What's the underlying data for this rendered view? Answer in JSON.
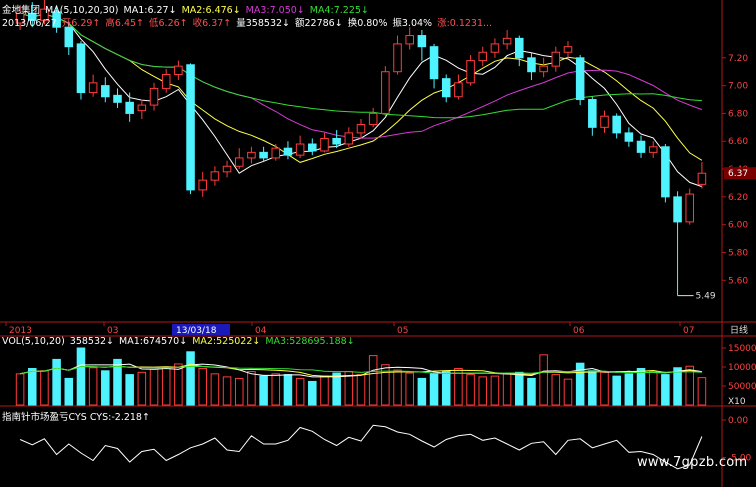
{
  "header": {
    "stock_name": "金地集团",
    "ma_label": "MA(5,10,20,30)",
    "ma1": "MA1:6.27↓",
    "ma2": "MA2:6.476↓",
    "ma3": "MA3:7.050↓",
    "ma4": "MA4:7.225↓",
    "date": "2013/06/27",
    "open": "开6.29↑",
    "high": "高6.45↑",
    "low": "低6.26↑",
    "close": "收6.37↑",
    "volume": "量358532↓",
    "amount": "额22786↓",
    "turnover": "换0.80%",
    "amplitude": "振3.04%",
    "change": "涨:0.1231..."
  },
  "colors": {
    "up": "#ff3b3b",
    "down": "#4ff2ff",
    "ma1": "#ffffff",
    "ma2": "#ffff4a",
    "ma3": "#d53bd5",
    "ma4": "#33dd33",
    "axis": "#b01818",
    "date_axis_bg": "#000000"
  },
  "price_axis": {
    "ticks": [
      "7.20",
      "7.00",
      "6.80",
      "6.60",
      "6.40",
      "6.20",
      "6.00",
      "5.80",
      "5.60"
    ],
    "current_label": "6.37",
    "low_label": "5.49"
  },
  "date_axis": {
    "labels": [
      "2013",
      "03",
      "04",
      "05",
      "06",
      "07"
    ],
    "selected": "13/03/18",
    "period_label": "日线"
  },
  "volume_panel": {
    "label": "VOL(5,10,20)",
    "vol": "358532↓",
    "ma1": "MA1:674570↓",
    "ma2": "MA2:525022↓",
    "ma3": "MA3:528695.188↓",
    "ticks": [
      "150000",
      "100000",
      "50000"
    ],
    "unit": "X10"
  },
  "indicator_panel": {
    "label": "指南针市场盈亏CYS",
    "value": "CYS:-2.218↑",
    "ticks": [
      "0.00",
      "-5.00"
    ]
  },
  "watermark": "www.7gpzb.com",
  "chart_data": {
    "type": "line",
    "title": "",
    "price_range": [
      5.3,
      7.4
    ],
    "candles": [
      [
        7.45,
        7.52,
        7.58,
        7.4
      ],
      [
        7.52,
        7.47,
        7.6,
        7.42
      ],
      [
        7.47,
        7.55,
        7.62,
        7.44
      ],
      [
        7.53,
        7.42,
        7.58,
        7.38
      ],
      [
        7.42,
        7.28,
        7.46,
        7.22
      ],
      [
        7.3,
        6.95,
        7.32,
        6.9
      ],
      [
        6.95,
        7.02,
        7.08,
        6.92
      ],
      [
        7.0,
        6.92,
        7.06,
        6.88
      ],
      [
        6.93,
        6.88,
        6.98,
        6.84
      ],
      [
        6.88,
        6.8,
        6.95,
        6.74
      ],
      [
        6.82,
        6.86,
        6.9,
        6.76
      ],
      [
        6.86,
        6.98,
        7.02,
        6.82
      ],
      [
        6.98,
        7.08,
        7.12,
        6.95
      ],
      [
        7.08,
        7.14,
        7.18,
        7.04
      ],
      [
        7.15,
        6.25,
        7.16,
        6.22
      ],
      [
        6.25,
        6.32,
        6.38,
        6.2
      ],
      [
        6.32,
        6.38,
        6.42,
        6.28
      ],
      [
        6.38,
        6.42,
        6.46,
        6.34
      ],
      [
        6.42,
        6.48,
        6.55,
        6.4
      ],
      [
        6.48,
        6.52,
        6.56,
        6.44
      ],
      [
        6.52,
        6.48,
        6.56,
        6.45
      ],
      [
        6.48,
        6.55,
        6.58,
        6.46
      ],
      [
        6.55,
        6.5,
        6.6,
        6.47
      ],
      [
        6.5,
        6.58,
        6.64,
        6.48
      ],
      [
        6.58,
        6.53,
        6.62,
        6.5
      ],
      [
        6.53,
        6.62,
        6.66,
        6.52
      ],
      [
        6.62,
        6.58,
        6.68,
        6.55
      ],
      [
        6.58,
        6.66,
        6.7,
        6.56
      ],
      [
        6.66,
        6.72,
        6.76,
        6.62
      ],
      [
        6.72,
        6.8,
        6.84,
        6.7
      ],
      [
        6.8,
        7.1,
        7.14,
        6.78
      ],
      [
        7.1,
        7.3,
        7.36,
        7.08
      ],
      [
        7.3,
        7.36,
        7.42,
        7.26
      ],
      [
        7.36,
        7.28,
        7.4,
        7.18
      ],
      [
        7.28,
        7.05,
        7.3,
        6.98
      ],
      [
        7.05,
        6.92,
        7.08,
        6.88
      ],
      [
        6.92,
        7.02,
        7.08,
        6.9
      ],
      [
        7.02,
        7.18,
        7.22,
        7.0
      ],
      [
        7.18,
        7.24,
        7.28,
        7.14
      ],
      [
        7.24,
        7.3,
        7.34,
        7.2
      ],
      [
        7.3,
        7.34,
        7.4,
        7.26
      ],
      [
        7.34,
        7.2,
        7.36,
        7.14
      ],
      [
        7.2,
        7.1,
        7.24,
        7.04
      ],
      [
        7.1,
        7.14,
        7.2,
        7.06
      ],
      [
        7.14,
        7.24,
        7.28,
        7.1
      ],
      [
        7.24,
        7.28,
        7.32,
        7.2
      ],
      [
        7.2,
        6.9,
        7.22,
        6.86
      ],
      [
        6.9,
        6.7,
        6.92,
        6.64
      ],
      [
        6.7,
        6.78,
        6.82,
        6.66
      ],
      [
        6.78,
        6.66,
        6.8,
        6.62
      ],
      [
        6.66,
        6.6,
        6.7,
        6.56
      ],
      [
        6.6,
        6.52,
        6.64,
        6.48
      ],
      [
        6.52,
        6.56,
        6.6,
        6.48
      ],
      [
        6.56,
        6.2,
        6.58,
        6.16
      ],
      [
        6.2,
        6.02,
        6.24,
        5.49
      ],
      [
        6.02,
        6.22,
        6.26,
        6.0
      ],
      [
        6.29,
        6.37,
        6.45,
        6.26
      ]
    ],
    "volume": [
      82,
      96,
      90,
      120,
      70,
      150,
      98,
      90,
      120,
      80,
      86,
      94,
      100,
      108,
      140,
      96,
      82,
      74,
      70,
      88,
      76,
      82,
      80,
      70,
      62,
      76,
      84,
      88,
      80,
      130,
      106,
      92,
      84,
      70,
      82,
      88,
      96,
      80,
      74,
      76,
      82,
      86,
      70,
      132,
      80,
      68,
      110,
      90,
      86,
      76,
      82,
      96,
      88,
      80,
      98,
      102,
      72
    ],
    "cys": [
      -2.6,
      -3.3,
      -2.5,
      -4.6,
      -3.2,
      -4.4,
      -5.4,
      -3.4,
      -3.8,
      -5.6,
      -4.2,
      -3.9,
      -5.4,
      -4.6,
      -3.7,
      -3.2,
      -2.4,
      -4.0,
      -4.2,
      -2.1,
      -3.2,
      -3.2,
      -2.7,
      -1.0,
      -1.5,
      -2.6,
      -3.4,
      -2.3,
      -2.8,
      -0.7,
      -0.9,
      -1.6,
      -1.9,
      -2.8,
      -3.6,
      -2.6,
      -2.1,
      -1.9,
      -2.7,
      -2.4,
      -3.2,
      -4.0,
      -3.1,
      -2.9,
      -4.6,
      -2.7,
      -2.5,
      -3.7,
      -3.2,
      -2.7,
      -4.3,
      -4.2,
      -4.6,
      -5.6,
      -6.5,
      -6.0,
      -2.2
    ]
  }
}
